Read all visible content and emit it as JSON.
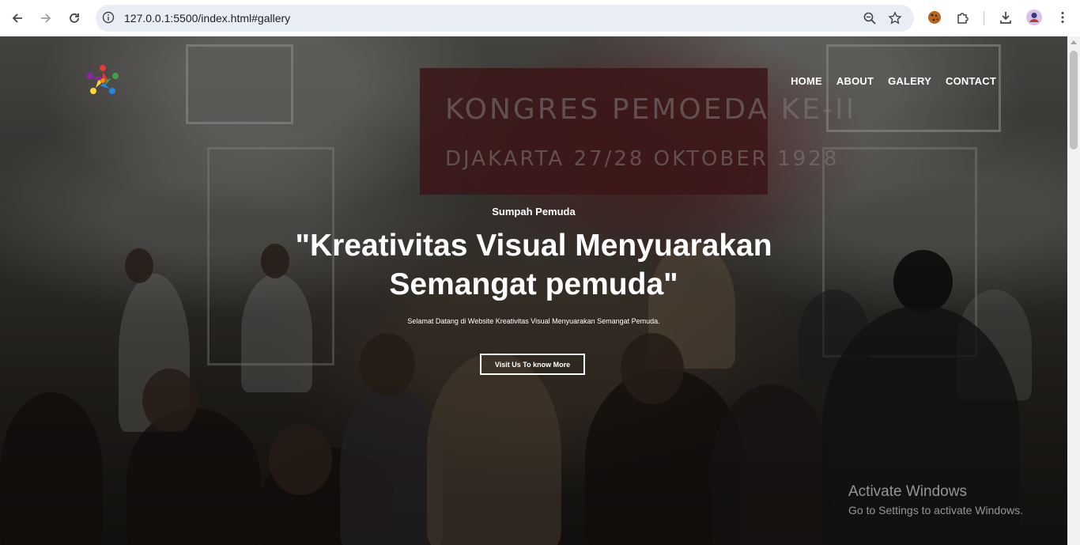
{
  "browser": {
    "url": "127.0.0.1:5500/index.html#gallery",
    "back_icon": "arrow-left-icon",
    "forward_icon": "arrow-right-icon",
    "reload_icon": "reload-icon",
    "site_info_icon": "info-icon",
    "zoom_icon": "zoom-icon",
    "bookmark_icon": "star-icon",
    "extensions": [
      "cookie-extension-icon",
      "puzzle-icon",
      "download-icon",
      "profile-avatar",
      "more-vert-icon"
    ]
  },
  "site": {
    "logo": "colorful-people-circle-logo",
    "nav": [
      "HOME",
      "ABOUT",
      "GALERY",
      "CONTACT"
    ],
    "hero": {
      "eyebrow": "Sumpah Pemuda",
      "headline_line1": "\"Kreativitas Visual Menyuarakan",
      "headline_line2": "Semangat pemuda\"",
      "tagline": "Selamat Datang di Website Kreativitas Visual Menyuarakan Semangat Pemuda.",
      "cta": "Visit Us To know More"
    },
    "background_banner": {
      "line1": "KONGRES  PEMOEDA  KE-II",
      "line2": "DJAKARTA 27/28  OKTOBER  1928"
    }
  },
  "watermark": {
    "title": "Activate Windows",
    "subtitle": "Go to Settings to activate Windows."
  }
}
